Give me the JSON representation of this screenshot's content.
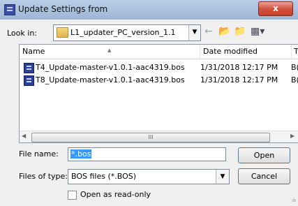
{
  "window": {
    "title": "Update Settings from",
    "close_glyph": "x"
  },
  "lookin": {
    "label": "Look in:",
    "value": "L1_updater_PC_version_1.1",
    "icons": [
      "back-arrow-icon",
      "up-folder-icon",
      "new-folder-icon",
      "view-menu-icon"
    ]
  },
  "list": {
    "columns": [
      "Name",
      "Date modified",
      "Ty"
    ],
    "rows": [
      {
        "name": "T4_Update-master-v1.0.1-aac4319.bos",
        "date": "1/31/2018 12:17 PM",
        "type": "B("
      },
      {
        "name": "T8_Update-master-v1.0.1-aac4319.bos",
        "date": "1/31/2018 12:17 PM",
        "type": "B("
      }
    ],
    "scroll_thumb_glyph": "III"
  },
  "filename": {
    "label": "File name:",
    "value": "*.bos"
  },
  "filetype": {
    "label": "Files of type:",
    "value": "BOS files (*.BOS)"
  },
  "buttons": {
    "open": "Open",
    "cancel": "Cancel"
  },
  "readonly": {
    "label": "Open as read-only",
    "checked": false
  }
}
